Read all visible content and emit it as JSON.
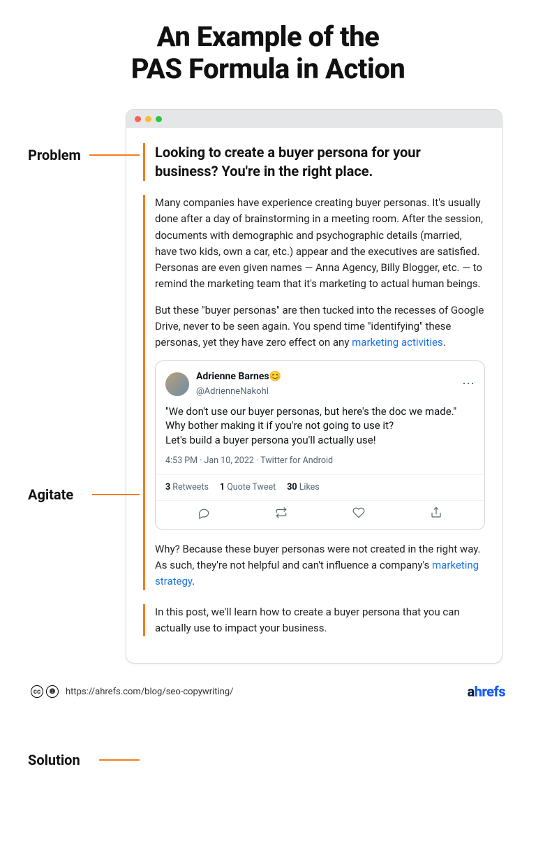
{
  "title": "An Example of the\nPAS Formula in Action",
  "labels": {
    "problem": "Problem",
    "agitate": "Agitate",
    "solution": "Solution"
  },
  "sections": {
    "problem": {
      "headline": "Looking to create a buyer persona for your business? You're in the right place."
    },
    "agitate": {
      "p1": "Many companies have experience creating buyer personas. It's usually done after a day of brainstorming in a meeting room. After the session, documents with demographic and psychographic details (married, have two kids, own a car, etc.) appear and the executives are satisfied. Personas are even given names — Anna Agency, Billy Blogger, etc. — to remind the marketing team that it's marketing to actual human beings.",
      "p2_pre": "But these \"buyer personas\" are then tucked into the recesses of Google Drive, never to be seen again. You spend time \"identifying\" these personas, yet they have zero effect on any ",
      "p2_link": "marketing activities",
      "p2_post": ".",
      "p3_pre": "Why? Because these buyer personas were not created in the right way. As such, they're not helpful and can't influence a company's ",
      "p3_link": "marketing strategy",
      "p3_post": "."
    },
    "solution": {
      "text": "In this post, we'll learn how to create a buyer persona that you can actually use to impact your business."
    }
  },
  "tweet": {
    "name": "Adrienne Barnes😊",
    "handle": "@AdrienneNakohl",
    "text": "\"We don't use our buyer personas, but here's the doc we made.\"\nWhy bother making it if you're not going to use it?\nLet's build a buyer persona you'll actually use!",
    "time": "4:53 PM · Jan 10, 2022 · Twitter for Android",
    "retweets": "3",
    "retweets_label": "Retweets",
    "quotes": "1",
    "quotes_label": "Quote Tweet",
    "likes": "30",
    "likes_label": "Likes"
  },
  "footer": {
    "url": "https://ahrefs.com/blog/seo-copywriting/",
    "brand_a": "a",
    "brand_rest": "hrefs"
  }
}
